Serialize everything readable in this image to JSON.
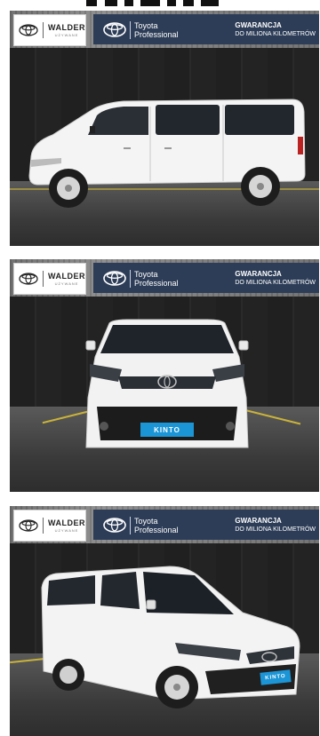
{
  "dealer": {
    "name": "WALDER",
    "tagline": "UŻYWANE"
  },
  "program": {
    "brand_line1": "Toyota",
    "brand_line2": "Professional",
    "guarantee_line1": "GWARANCJA",
    "guarantee_line2": "DO MILIONA KILOMETRÓW"
  },
  "cards": [
    {
      "view": "side",
      "plate": ""
    },
    {
      "view": "front",
      "plate": "KINTO"
    },
    {
      "view": "three-quarter",
      "plate": "KINTO"
    }
  ],
  "colors": {
    "panel": "#2d3d57",
    "plate": "#1b95d6",
    "van": "#f4f4f4",
    "floor_stripe": "#c9b23a"
  },
  "icons": [
    "toyota-logo-icon"
  ]
}
